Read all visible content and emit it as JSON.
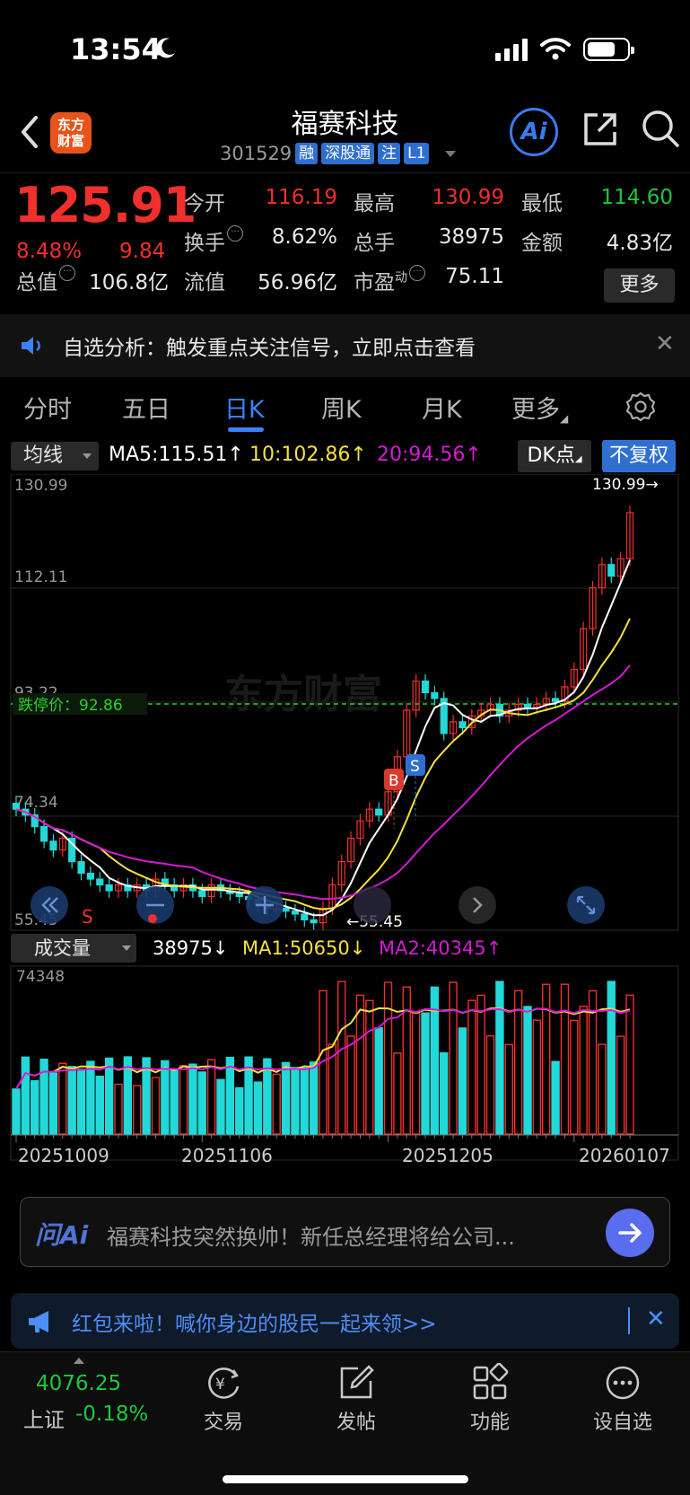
{
  "status": {
    "time": "13:54"
  },
  "header": {
    "logo_text": "东方财富",
    "stock_name": "福赛科技",
    "stock_code": "301529",
    "tags": [
      "融",
      "深股通",
      "注",
      "L1"
    ],
    "ai_label": "Ai"
  },
  "quote": {
    "price": "125.91",
    "change_pct": "8.48%",
    "change_amt": "9.84",
    "open_label": "今开",
    "open": "116.19",
    "high_label": "最高",
    "high": "130.99",
    "low_label": "最低",
    "low": "114.60",
    "turnover_label": "换手",
    "turnover": "8.62%",
    "volume_label": "总手",
    "volume": "38975",
    "amount_label": "金额",
    "amount": "4.83亿",
    "mcap_label": "总值",
    "mcap": "106.8亿",
    "float_label": "流值",
    "float_cap": "56.96亿",
    "pe_label": "市盈",
    "pe_sup": "动",
    "pe": "75.11",
    "more_label": "更多"
  },
  "notice": {
    "text": "自选分析：触发重点关注信号，立即点击查看"
  },
  "tabs": [
    "分时",
    "五日",
    "日K",
    "周K",
    "月K",
    "更多",
    "settings"
  ],
  "ma_bar": {
    "dropdown": "均线",
    "ma5": "MA5:115.51↑",
    "ma10": "10:102.86↑",
    "ma20": "20:94.56↑",
    "dk_label": "DK点",
    "fq_label": "不复权"
  },
  "kline": {
    "price_labels": [
      "130.99",
      "112.11",
      "93.22",
      "74.34",
      "55.45"
    ],
    "max_label": "130.99→",
    "min_label": "←55.45",
    "limit_down": "跌停价：92.86",
    "watermark": "东方财富",
    "buy_label": "B",
    "sell_label": "S",
    "s_mark": "S"
  },
  "volume_bar": {
    "dropdown": "成交量",
    "vol": "38975↓",
    "ma1": "MA1:50650↓",
    "ma2": "MA2:40345↑",
    "max_label": "74348"
  },
  "dates": [
    "20251009",
    "20251106",
    "20251205",
    "20260107"
  ],
  "ai_box": {
    "logo": "问Ai",
    "text": "福赛科技突然换帅！新任总经理将给公司..."
  },
  "banner": {
    "text": "红包来啦！喊你身边的股民一起来领>>"
  },
  "bottom": {
    "index_value": "4076.25",
    "index_name": "上证",
    "index_pct": "-0.18%",
    "nav": [
      "交易",
      "发帖",
      "功能",
      "设自选"
    ]
  },
  "colors": {
    "up": "#f0302c",
    "down": "#22d8d8",
    "ma5": "#ffffff",
    "ma10": "#f4e23c",
    "ma20": "#d41bd4",
    "accent": "#3b82f6",
    "limit": "#24d424"
  }
}
